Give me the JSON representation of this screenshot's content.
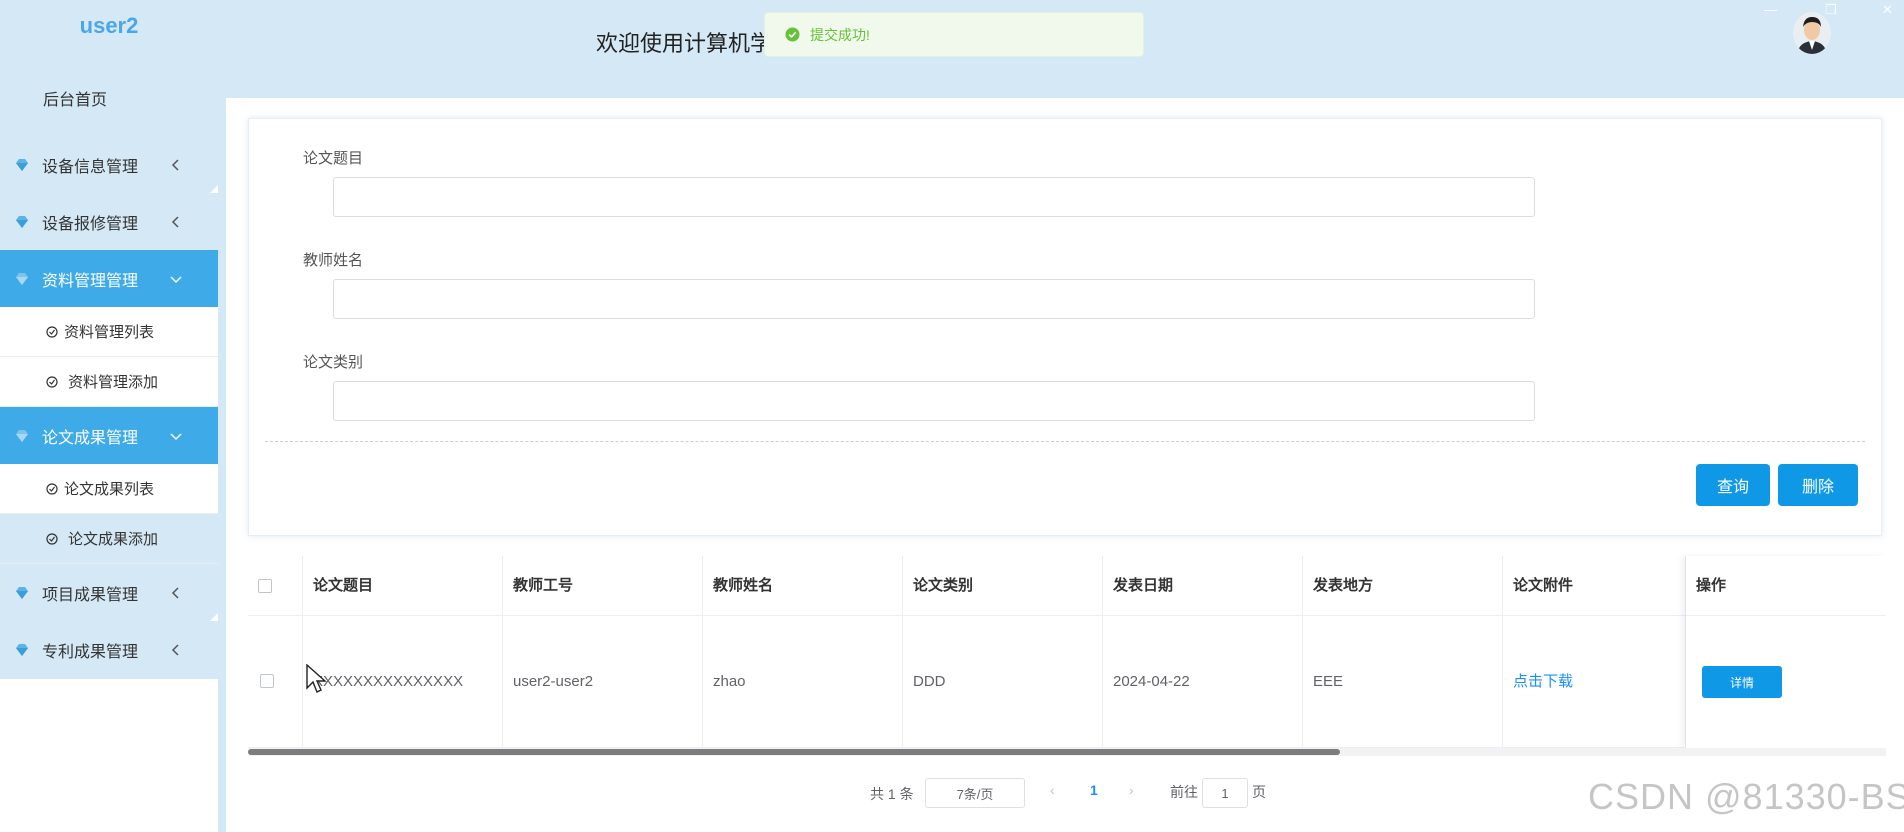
{
  "sidebar": {
    "brand": "user2",
    "home": "后台首页",
    "menus": [
      {
        "label": "设备信息管理"
      },
      {
        "label": "设备报修管理"
      },
      {
        "label": "资料管理管理"
      },
      {
        "label": "论文成果管理"
      },
      {
        "label": "项目成果管理"
      },
      {
        "label": "专利成果管理"
      }
    ],
    "submenu_ziliao": [
      "资料管理列表",
      "资料管理添加"
    ],
    "submenu_lunwen": [
      "论文成果列表",
      "论文成果添加"
    ]
  },
  "header": {
    "welcome": "欢迎使用计算机学",
    "toast": "提交成功!"
  },
  "search": {
    "fields": [
      {
        "label": "论文题目",
        "value": ""
      },
      {
        "label": "教师姓名",
        "value": ""
      },
      {
        "label": "论文类别",
        "value": ""
      }
    ],
    "query_btn": "查询",
    "delete_btn": "删除"
  },
  "table": {
    "columns": [
      "论文题目",
      "教师工号",
      "教师姓名",
      "论文类别",
      "发表日期",
      "发表地方",
      "论文附件",
      "操作"
    ],
    "rows": [
      {
        "title": "XXXXXXXXXXXXXXX",
        "teacher_id": "user2-user2",
        "teacher_name": "zhao",
        "category": "DDD",
        "date": "2024-04-22",
        "place": "EEE",
        "attachment": "点击下载",
        "action": "详情"
      }
    ]
  },
  "pagination": {
    "total": "共 1 条",
    "page_size": "7条/页",
    "current": "1",
    "goto_label": "前往",
    "goto_value": "1",
    "page_suffix": "页"
  },
  "watermark": "CSDN @81330-BS",
  "colors": {
    "sidebar_bg": "#d4e8f5",
    "active": "#3eaae8",
    "primary_btn": "#0e98e6",
    "link": "#1890ff",
    "success": "#67c23a"
  }
}
